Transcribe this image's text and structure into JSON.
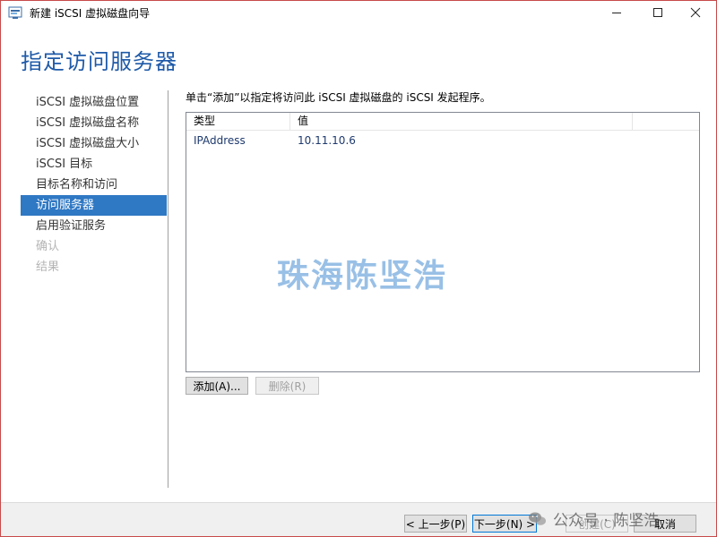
{
  "window": {
    "title": "新建 iSCSI 虚拟磁盘向导",
    "controls": {
      "minimize": "—",
      "maximize": "☐",
      "close": "✕"
    }
  },
  "page": {
    "heading": "指定访问服务器"
  },
  "nav": {
    "items": [
      {
        "label": "iSCSI 虚拟磁盘位置",
        "state": "normal"
      },
      {
        "label": "iSCSI 虚拟磁盘名称",
        "state": "normal"
      },
      {
        "label": "iSCSI 虚拟磁盘大小",
        "state": "normal"
      },
      {
        "label": "iSCSI 目标",
        "state": "normal"
      },
      {
        "label": "目标名称和访问",
        "state": "normal"
      },
      {
        "label": "访问服务器",
        "state": "selected"
      },
      {
        "label": "启用验证服务",
        "state": "normal"
      },
      {
        "label": "确认",
        "state": "disabled"
      },
      {
        "label": "结果",
        "state": "disabled"
      }
    ]
  },
  "main": {
    "instruction": "单击“添加”以指定将访问此 iSCSI 虚拟磁盘的 iSCSI 发起程序。",
    "table": {
      "columns": [
        "类型",
        "值",
        ""
      ],
      "rows": [
        {
          "type": "IPAddress",
          "value": "10.11.10.6"
        }
      ]
    },
    "add_button": "添加(A)...",
    "remove_button": "删除(R)"
  },
  "footer": {
    "prev_button": "< 上一步(P)",
    "next_button": "下一步(N) >",
    "create_button": "创建(C)",
    "cancel_button": "取消"
  },
  "watermarks": {
    "center": "珠海陈坚浩",
    "footer": "公众号 · 陈坚浩"
  },
  "colors": {
    "accent": "#2f78c4",
    "heading": "#1e5aa8",
    "window_border": "#c84a4a"
  }
}
